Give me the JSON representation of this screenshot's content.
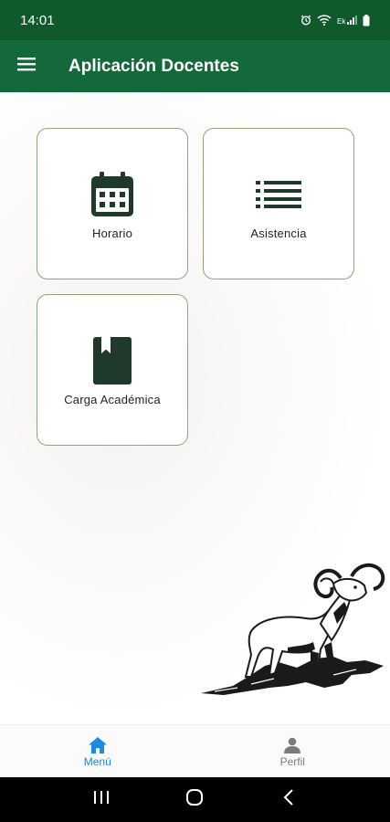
{
  "status_bar": {
    "time": "14:01",
    "icons": [
      "alarm-icon",
      "wifi-icon",
      "signal-icon",
      "battery-icon"
    ]
  },
  "app_bar": {
    "title": "Aplicación Docentes",
    "menu_icon": "hamburger-icon"
  },
  "colors": {
    "status_bar": "#0f5a2c",
    "app_bar": "#13693a",
    "card_border": "#8ea77a",
    "icon_dark": "#1f3a2a",
    "nav_active": "#1e88e5",
    "nav_inactive": "#7b7b7b"
  },
  "cards": [
    {
      "label": "Horario",
      "icon": "calendar-icon"
    },
    {
      "label": "Asistencia",
      "icon": "list-icon"
    },
    {
      "label": "Carga Académica",
      "icon": "book-icon"
    }
  ],
  "bottom_nav": {
    "items": [
      {
        "label": "Menú",
        "icon": "home-icon",
        "active": true
      },
      {
        "label": "Perfil",
        "icon": "person-icon",
        "active": false
      }
    ]
  },
  "system_nav": [
    "recent-apps-icon",
    "home-circle-icon",
    "back-icon"
  ]
}
